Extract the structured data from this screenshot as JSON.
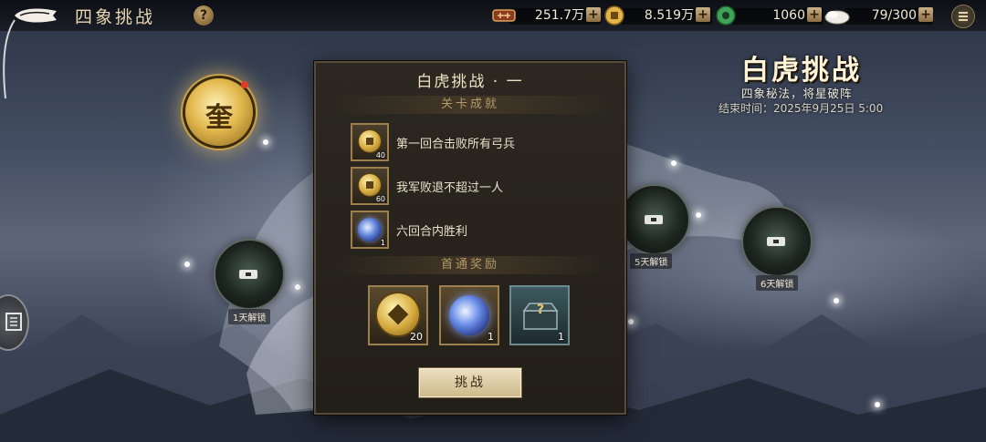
{
  "topbar": {
    "title": "四象挑战",
    "help_label": "?",
    "resources": [
      {
        "icon": "tiger-token-icon",
        "value": "251.7万"
      },
      {
        "icon": "gold-coin-icon",
        "value": "8.519万"
      },
      {
        "icon": "jade-icon",
        "value": "1060"
      },
      {
        "icon": "rice-icon",
        "value": "79/300"
      }
    ],
    "plus_label": "+"
  },
  "event": {
    "title": "白虎挑战",
    "subtitle": "四象秘法，将星破阵",
    "end_time": "结束时间：2025年9月25日 5:00"
  },
  "map": {
    "current_node_label": "奎",
    "locked_nodes": [
      {
        "label": "1天解锁"
      },
      {
        "label": "5天解锁"
      },
      {
        "label": "6天解锁"
      }
    ]
  },
  "dialog": {
    "title": "白虎挑战 · 一",
    "achievements_header": "关卡成就",
    "achievements": [
      {
        "text": "第一回合击败所有弓兵",
        "icon": "gold-coin-icon",
        "qty": "40"
      },
      {
        "text": "我军败退不超过一人",
        "icon": "gold-coin-icon",
        "qty": "60"
      },
      {
        "text": "六回合内胜利",
        "icon": "blue-orb-icon",
        "qty": "1"
      }
    ],
    "rewards_header": "首通奖励",
    "rewards": [
      {
        "icon": "gold-coin-icon",
        "qty": "20"
      },
      {
        "icon": "blue-orb-icon",
        "qty": "1"
      },
      {
        "icon": "mystery-chest-icon",
        "qty": "1"
      }
    ],
    "challenge_label": "挑战"
  },
  "colors": {
    "accent_gold": "#c9a871",
    "panel_bg": "#26221b",
    "button_bg": "#ddcca4"
  }
}
